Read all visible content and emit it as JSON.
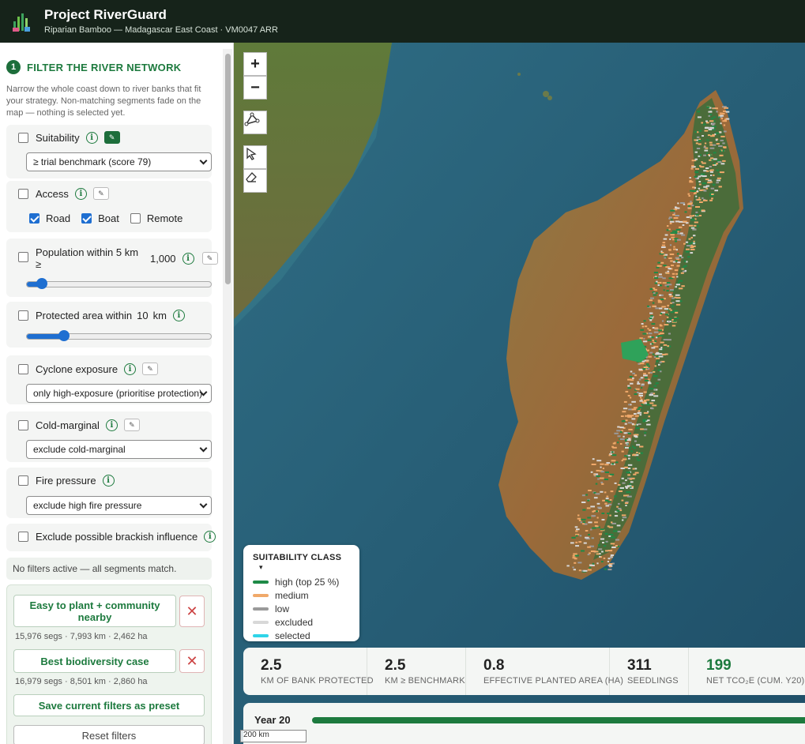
{
  "header": {
    "title": "Project RiverGuard",
    "subtitle": "Riparian Bamboo — Madagascar East Coast · VM0047 ARR"
  },
  "sidebar": {
    "step": "1",
    "section_title": "FILTER THE RIVER NETWORK",
    "section_desc": "Narrow the whole coast down to river banks that fit your strategy. Non-matching segments fade on the map — nothing is selected yet.",
    "filters": {
      "suitability": {
        "label": "Suitability",
        "select": "≥ trial benchmark (score 79)"
      },
      "access": {
        "label": "Access",
        "options": [
          {
            "label": "Road",
            "checked": true
          },
          {
            "label": "Boat",
            "checked": true
          },
          {
            "label": "Remote",
            "checked": false
          }
        ]
      },
      "population": {
        "label": "Population within 5 km",
        "label_suffix": "≥",
        "value": "1,000",
        "slider_fraction": 0.08
      },
      "protected": {
        "label": "Protected area within",
        "value": "10",
        "unit": "km",
        "slider_fraction": 0.2
      },
      "cyclone": {
        "label": "Cyclone exposure",
        "select": "only high-exposure (prioritise protection)"
      },
      "cold": {
        "label": "Cold-marginal",
        "select": "exclude cold-marginal"
      },
      "fire": {
        "label": "Fire pressure",
        "select": "exclude high fire pressure"
      },
      "brackish": {
        "label": "Exclude possible brackish influence"
      }
    },
    "status": "No filters active — all segments match.",
    "presets": [
      {
        "label": "Easy to plant + community nearby",
        "meta": "15,976 segs · 7,993 km · 2,462 ha"
      },
      {
        "label": "Best biodiversity case",
        "meta": "16,979 segs · 8,501 km · 2,860 ha"
      }
    ],
    "save_preset": "Save current filters as preset",
    "reset": "Reset filters",
    "info_glyph": "i",
    "pen_glyph": "✎",
    "remove_glyph": "✕"
  },
  "map": {
    "zoom_in": "+",
    "zoom_out": "−",
    "legend": {
      "title": "SUITABILITY CLASS",
      "toggle": "▾",
      "items": [
        {
          "label": "high (top 25 %)",
          "color": "#1e8a47"
        },
        {
          "label": "medium",
          "color": "#f0a96a"
        },
        {
          "label": "low",
          "color": "#9a9a9a"
        },
        {
          "label": "excluded",
          "color": "#d8d8d8"
        },
        {
          "label": "selected",
          "color": "#2fd4e8"
        }
      ]
    },
    "stats": [
      {
        "value": "2.5",
        "label": "km of bank protected"
      },
      {
        "value": "2.5",
        "label": "km ≥ benchmark"
      },
      {
        "value": "0.8",
        "label": "Effective planted area (ha)"
      },
      {
        "value": "311",
        "label": "Seedlings"
      },
      {
        "value": "199",
        "label": "Net tCO₂e (cum. Y20)"
      }
    ],
    "timeline": {
      "label": "Year 20"
    },
    "scale": "200 km"
  },
  "colors": {
    "header_bg": "#16231a",
    "accent": "#1d7a3e",
    "ocean": "#2a5d76"
  }
}
